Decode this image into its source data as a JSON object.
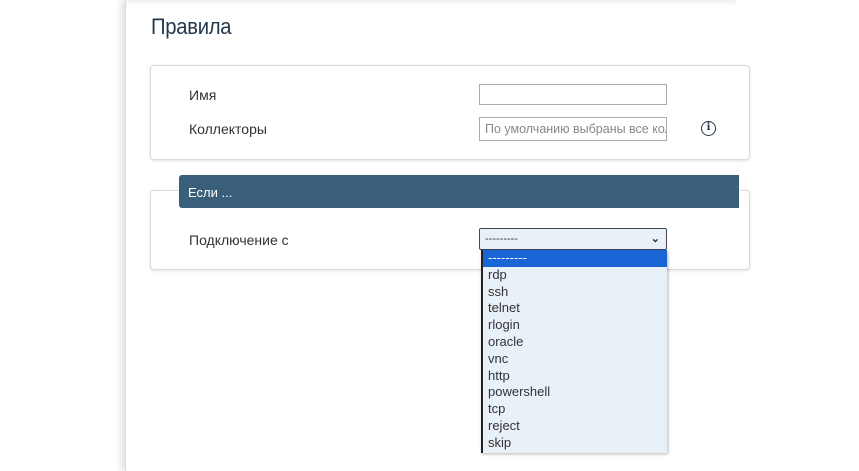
{
  "page": {
    "title": "Правила"
  },
  "form": {
    "name_label": "Имя",
    "name_value": "",
    "collectors_label": "Коллекторы",
    "collectors_placeholder": "По умолчанию выбраны все коллекторы",
    "info_icon": "info-icon"
  },
  "condition": {
    "header": "Если ...",
    "connection_label": "Подключение с",
    "selected": "---------",
    "options": [
      "---------",
      "rdp",
      "ssh",
      "telnet",
      "rlogin",
      "oracle",
      "vnc",
      "http",
      "powershell",
      "tcp",
      "reject",
      "skip"
    ]
  }
}
